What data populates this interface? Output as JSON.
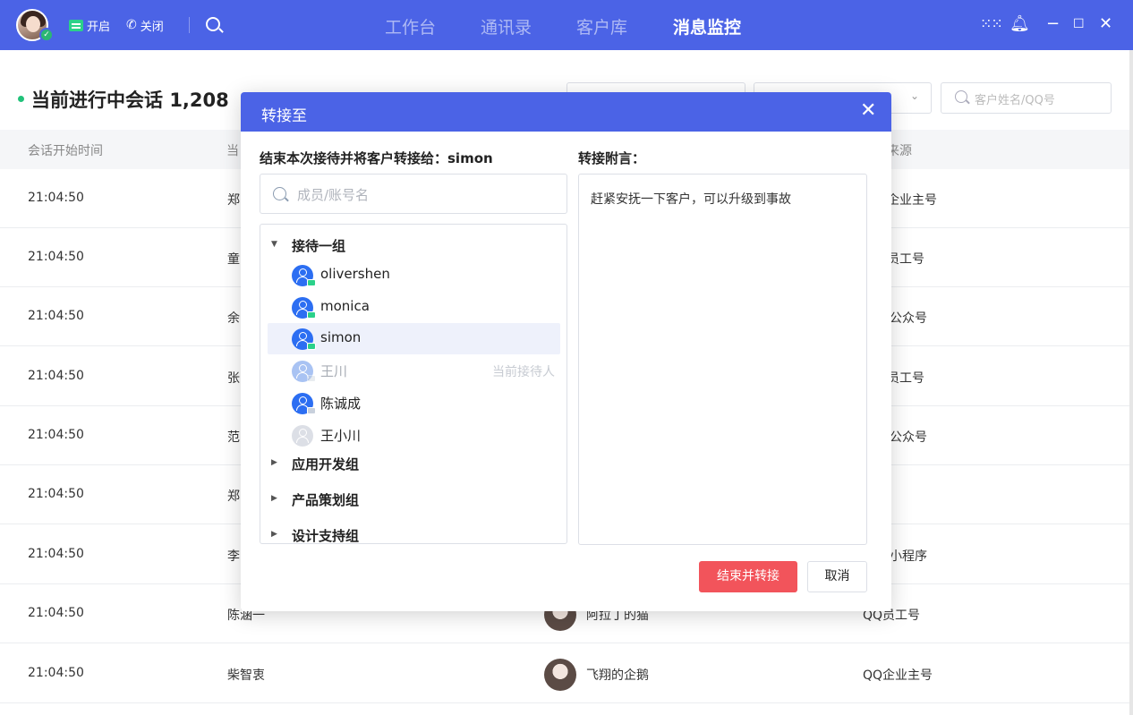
{
  "topbar": {
    "open_label": "开启",
    "close_label": "关闭",
    "nav": [
      {
        "label": "工作台",
        "active": false
      },
      {
        "label": "通讯录",
        "active": false
      },
      {
        "label": "客户库",
        "active": false
      },
      {
        "label": "消息监控",
        "active": true
      }
    ],
    "accent": "#4b63e6"
  },
  "page": {
    "title_prefix": "当前进行中会话",
    "count": "1,208",
    "search_placeholder": "客户姓名/QQ号"
  },
  "table": {
    "headers": [
      "会话开始时间",
      "当",
      "来源"
    ],
    "rows": [
      {
        "time": "21:04:50",
        "agent": "郑",
        "customer": "",
        "source": "企业主号"
      },
      {
        "time": "21:04:50",
        "agent": "童",
        "customer": "",
        "source": "员工号"
      },
      {
        "time": "21:04:50",
        "agent": "余",
        "customer": "",
        "source": "公众号"
      },
      {
        "time": "21:04:50",
        "agent": "张",
        "customer": "",
        "source": "员工号"
      },
      {
        "time": "21:04:50",
        "agent": "范",
        "customer": "",
        "source": "公众号"
      },
      {
        "time": "21:04:50",
        "agent": "郑",
        "customer": "",
        "source": ""
      },
      {
        "time": "21:04:50",
        "agent": "李",
        "customer": "",
        "source": "小程序"
      },
      {
        "time": "21:04:50",
        "agent": "陈涵一",
        "customer": "阿拉丁的猫",
        "source": "QQ员工号"
      },
      {
        "time": "21:04:50",
        "agent": "柴智衷",
        "customer": "飞翔的企鹅",
        "source": "QQ企业主号"
      }
    ]
  },
  "dialog": {
    "title": "转接至",
    "transfer_label": "结束本次接待并将客户转接给：simon",
    "note_label": "转接附言：",
    "member_search_placeholder": "成员/账号名",
    "note_text": "赶紧安抚一下客户，可以升级到事故",
    "groups": [
      {
        "name": "接待一组",
        "expanded": true
      },
      {
        "name": "应用开发组",
        "expanded": false
      },
      {
        "name": "产品策划组",
        "expanded": false
      },
      {
        "name": "设计支持组",
        "expanded": false
      }
    ],
    "members": [
      {
        "name": "olivershen",
        "tag": "",
        "state": "online"
      },
      {
        "name": "monica",
        "tag": "",
        "state": "online"
      },
      {
        "name": "simon",
        "tag": "",
        "state": "selected"
      },
      {
        "name": "王川",
        "tag": "当前接待人",
        "state": "disabled"
      },
      {
        "name": "陈诚成",
        "tag": "",
        "state": "online-grey"
      },
      {
        "name": "王小川",
        "tag": "",
        "state": "offline"
      }
    ],
    "confirm_label": "结束并转接",
    "cancel_label": "取消",
    "confirm_color": "#f2545b"
  }
}
